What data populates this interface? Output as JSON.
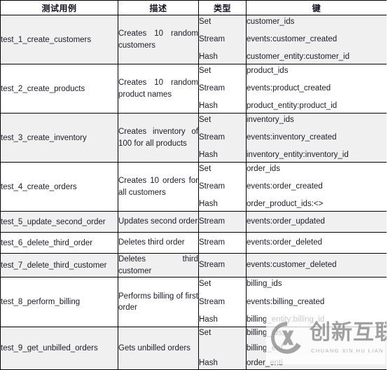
{
  "table": {
    "headers": [
      "测试用例",
      "描述",
      "类型",
      "键"
    ],
    "rows": [
      {
        "case": "test_1_create_customers",
        "desc": "Creates 10 random customers",
        "types": [
          "Set",
          "Stream",
          "Hash"
        ],
        "keys": [
          "customer_ids",
          "events:customer_created",
          "customer_entity:customer_id"
        ]
      },
      {
        "case": "test_2_create_products",
        "desc": "Creates 10 random product names",
        "types": [
          "Set",
          "Stream",
          "Hash"
        ],
        "keys": [
          "product_ids",
          "events:product_created",
          "product_entity:product_id"
        ]
      },
      {
        "case": "test_3_create_inventory",
        "desc": "Creates inventory of 100 for all products",
        "types": [
          "Set",
          "Stream",
          "Hash"
        ],
        "keys": [
          "inventory_ids",
          "events:inventory_created",
          "inventory_entity:inventory_id"
        ]
      },
      {
        "case": "test_4_create_orders",
        "desc": "Creates 10 orders for all customers",
        "types": [
          "Set",
          "Stream",
          "Hash"
        ],
        "keys": [
          "order_ids",
          "events:order_created",
          "order_product_ids:<>"
        ]
      },
      {
        "case": "test_5_update_second_order",
        "desc": "Updates second order",
        "types": [
          "Stream"
        ],
        "keys": [
          "events:order_updated"
        ]
      },
      {
        "case": "test_6_delete_third_order",
        "desc": "Deletes third order",
        "types": [
          "Stream"
        ],
        "keys": [
          "events:order_deleted"
        ]
      },
      {
        "case": "test_7_delete_third_customer",
        "desc": "Deletes third customer",
        "types": [
          "Stream"
        ],
        "keys": [
          "events:customer_deleted"
        ]
      },
      {
        "case": "test_8_perform_billing",
        "desc": "Performs billing of first order",
        "types": [
          "Set",
          "Stream",
          "Hash"
        ],
        "keys": [
          "billing_ids",
          "events:billing_created",
          "billing_entity:billing_id"
        ]
      },
      {
        "case": "test_9_get_unbilled_orders",
        "desc": "Gets unbilled orders",
        "types": [
          "Set",
          "Hash"
        ],
        "keys": [
          "billing_ids,",
          "billing_ent",
          "order_enti"
        ]
      }
    ]
  },
  "watermark": {
    "cn_text": "创新互联",
    "en_text": "CHUANG XIN HU LIAN"
  }
}
